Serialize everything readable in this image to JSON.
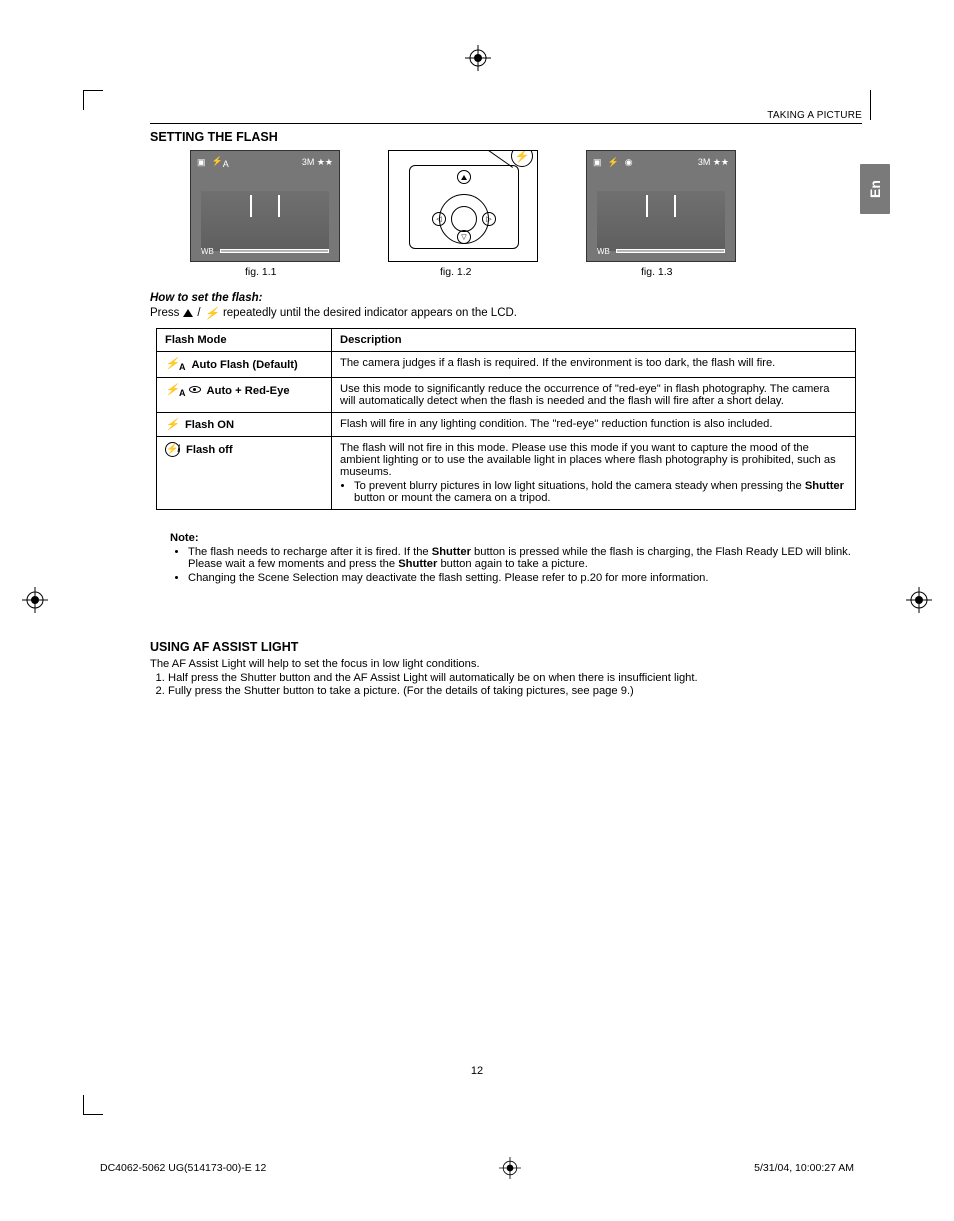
{
  "running_head": "TAKING A PICTURE",
  "lang_tab": "En",
  "section1_title": "SETTING THE FLASH",
  "fig1_caption": "fig. 1.1",
  "fig2_caption": "fig. 1.2",
  "fig3_caption": "fig. 1.3",
  "howto_label": "How to set the flash:",
  "press_prefix": "Press",
  "press_separator": "/",
  "press_suffix": "repeatedly until the desired indicator appears on the LCD.",
  "table": {
    "h1": "Flash Mode",
    "h2": "Description",
    "rows": [
      {
        "icon_sub": "A",
        "mode": "Auto Flash (Default)",
        "desc": "The camera judges if a flash is required. If the environment is too dark, the flash will fire."
      },
      {
        "icon_sub": "A",
        "has_eye": true,
        "mode": "Auto + Red-Eye",
        "desc": "Use this mode to significantly reduce the occurrence of \"red-eye\" in flash photography. The camera will automatically detect when the flash is needed and the flash will fire after a short delay."
      },
      {
        "mode": "Flash ON",
        "desc": "Flash will fire in any lighting condition. The \"red-eye\" reduction function is also included."
      },
      {
        "flash_off": true,
        "mode": "Flash off",
        "desc_main": "The flash will not fire in this mode. Please use this mode if you want to capture the mood of the ambient lighting or to use the available light in places where flash photography is prohibited, such as museums.",
        "bullet_pre": "To prevent blurry pictures in low light situations, hold the camera steady when pressing the ",
        "bullet_bold": "Shutter",
        "bullet_post": " button or mount the camera on a tripod."
      }
    ]
  },
  "note": {
    "label": "Note:",
    "item1_pre": "The flash needs to recharge after it is fired. If the ",
    "item1_b1": "Shutter",
    "item1_mid": " button is pressed while the flash is charging, the Flash Ready LED will blink. Please wait a few moments and press the ",
    "item1_b2": "Shutter",
    "item1_post": " button again to take a picture.",
    "item2": "Changing the Scene Selection may deactivate the flash setting. Please refer to p.20 for more information."
  },
  "section2_title": "USING AF ASSIST LIGHT",
  "af_intro": "The AF Assist Light will help to set the focus in low light conditions.",
  "af_step1": "Half press the Shutter button and the AF Assist Light will automatically be on when there is insufficient light.",
  "af_step2": "Fully press the Shutter button to take a picture. (For the details of taking pictures, see page 9.)",
  "page_number": "12",
  "footer_left": "DC4062-5062 UG(514173-00)-E   12",
  "footer_right": "5/31/04, 10:00:27 AM",
  "lcd_wb": "WB",
  "lcd_quality": "3M ★★",
  "callout_glyph": "⚡"
}
